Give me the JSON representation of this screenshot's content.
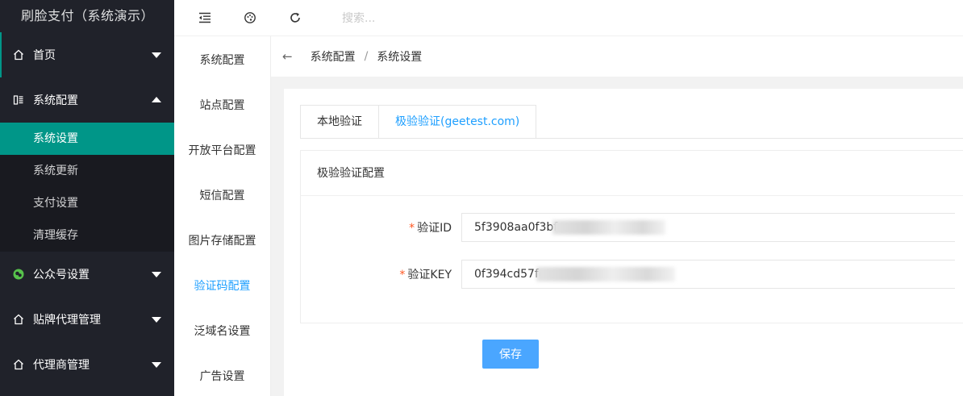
{
  "app": {
    "title": "刷脸支付（系统演示）"
  },
  "sidebar": {
    "items": [
      {
        "label": "首页",
        "icon": "home-icon"
      },
      {
        "label": "系统配置",
        "icon": "config-icon",
        "children": [
          "系统设置",
          "系统更新",
          "支付设置",
          "清理缓存"
        ]
      },
      {
        "label": "公众号设置",
        "icon": "wechat-icon"
      },
      {
        "label": "贴牌代理管理",
        "icon": "home-icon"
      },
      {
        "label": "代理商管理",
        "icon": "home-icon"
      }
    ],
    "active_child": "系统设置"
  },
  "header": {
    "search_placeholder": "搜索...",
    "icons": [
      "menu-fold-icon",
      "theme-icon",
      "refresh-icon"
    ]
  },
  "submenu": {
    "items": [
      "系统配置",
      "站点配置",
      "开放平台配置",
      "短信配置",
      "图片存储配置",
      "验证码配置",
      "泛域名设置",
      "广告设置"
    ],
    "active": "验证码配置"
  },
  "breadcrumb": {
    "back_icon": "←",
    "path": [
      "系统配置",
      "系统设置"
    ],
    "separator": "/"
  },
  "tabs": [
    {
      "label": "本地验证"
    },
    {
      "label": "极验验证(geetest.com)"
    }
  ],
  "active_tab": 1,
  "panel": {
    "title": "极验验证配置",
    "fields": [
      {
        "label": "验证ID",
        "required_mark": "*",
        "value": "5f3908aa0f3bfa"
      },
      {
        "label": "验证KEY",
        "required_mark": "*",
        "value": "0f394cd57fc"
      }
    ]
  },
  "buttons": {
    "save": "保存"
  },
  "colors": {
    "sidebar_bg": "#20222a",
    "active_green": "#009688",
    "accent_blue": "#1e9fff",
    "button_blue": "#4aa6ff"
  }
}
